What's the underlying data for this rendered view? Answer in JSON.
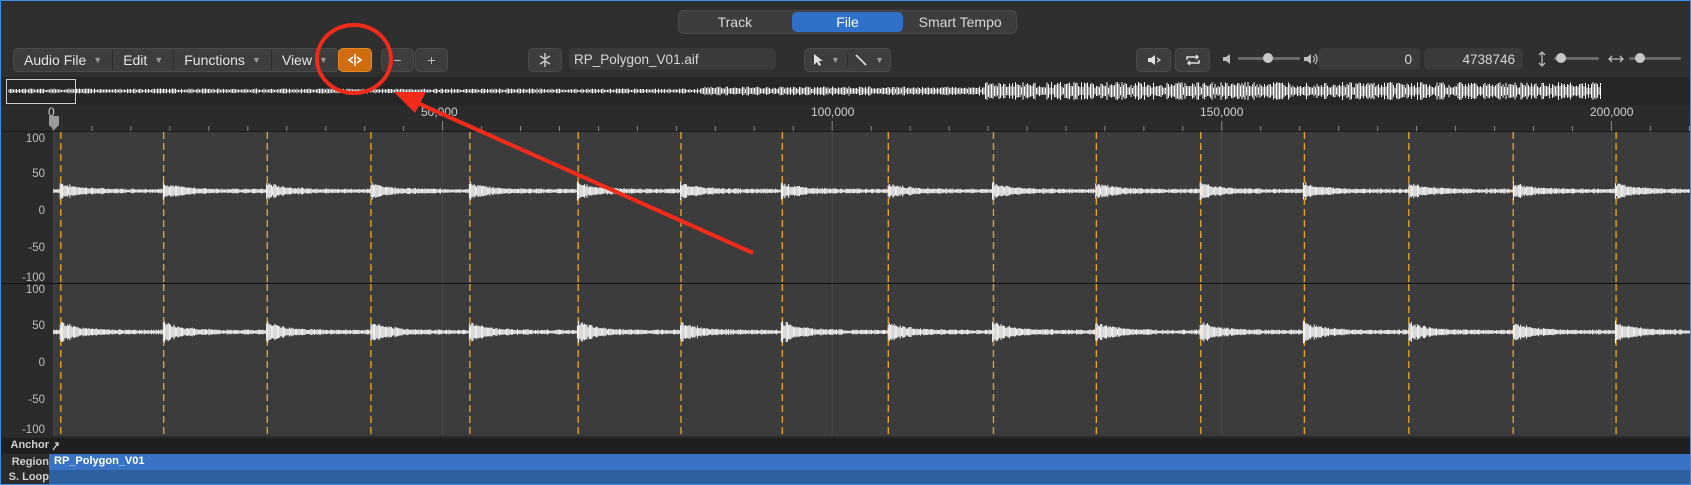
{
  "view_tabs": [
    {
      "label": "Track",
      "active": false
    },
    {
      "label": "File",
      "active": true
    },
    {
      "label": "Smart Tempo",
      "active": false
    }
  ],
  "menus": [
    {
      "label": "Audio File"
    },
    {
      "label": "Edit"
    },
    {
      "label": "Functions"
    },
    {
      "label": "View"
    }
  ],
  "toolbar": {
    "zoom_out": "−",
    "zoom_in": "+",
    "filename": "RP_Polygon_V01.aif",
    "start_value": "0",
    "end_value": "4738746"
  },
  "ruler": {
    "labels": [
      {
        "text": "0",
        "sample": 0
      },
      {
        "text": "50,000",
        "sample": 50000
      },
      {
        "text": "100,000",
        "sample": 100000
      },
      {
        "text": "150,000",
        "sample": 150000
      },
      {
        "text": "200,000",
        "sample": 200000
      }
    ]
  },
  "channel_axis": {
    "labels": [
      "100",
      "50",
      "0",
      "-50",
      "-100"
    ]
  },
  "transients": [
    1,
    14.2,
    27.5,
    40.8,
    53.5,
    67.4,
    80.6,
    93.6,
    107.2,
    120.7,
    133.9,
    147.3,
    160.6,
    174,
    187.4,
    200.6
  ],
  "bottom_rows": [
    {
      "label": "Anchor",
      "value": ""
    },
    {
      "label": "Region",
      "value": "RP_Polygon_V01"
    },
    {
      "label": "S. Loop",
      "value": ""
    }
  ],
  "colors": {
    "accent_blue": "#2f70c8",
    "transient_orange": "#e8a020",
    "annotation_red": "#f22b1b",
    "region_blue": "#3a73c4"
  },
  "annotation": {
    "circle_target": "transient-edit-mode-button",
    "arrow": "red arrow pointing to circled button"
  }
}
